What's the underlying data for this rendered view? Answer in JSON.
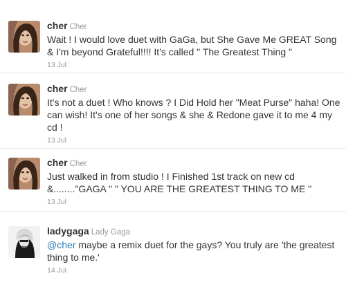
{
  "tweets": [
    {
      "screen_name": "cher",
      "full_name": "Cher",
      "text": "Wait ! I would love duet with GaGa, but She Gave Me GREAT Song & I'm beyond Grateful!!!! It's called \" The Greatest Thing \"",
      "timestamp": "13 Jul",
      "avatar_icon": "cher-avatar-icon"
    },
    {
      "screen_name": "cher",
      "full_name": "Cher",
      "text": "It's not a duet ! Who knows ? I Did Hold her \"Meat Purse\" haha! One can wish! It's one of her songs & she & Redone gave it to me 4 my cd !",
      "timestamp": "13 Jul",
      "avatar_icon": "cher-avatar-icon"
    },
    {
      "screen_name": "cher",
      "full_name": "Cher",
      "text": "Just walked in from studio ! I Finished 1st track on new cd &........\"GAGA \" \" YOU ARE THE GREATEST THING TO ME \"",
      "timestamp": "13 Jul",
      "avatar_icon": "cher-avatar-icon"
    },
    {
      "screen_name": "ladygaga",
      "full_name": "Lady Gaga",
      "mention": "@cher",
      "text": " maybe a remix duet for the gays? You truly are 'the greatest thing to me.'",
      "timestamp": "14 Jul",
      "avatar_icon": "ladygaga-avatar-icon"
    }
  ],
  "colors": {
    "text": "#333333",
    "muted": "#999999",
    "link": "#2b7bb9",
    "divider": "#e8e8e8"
  }
}
